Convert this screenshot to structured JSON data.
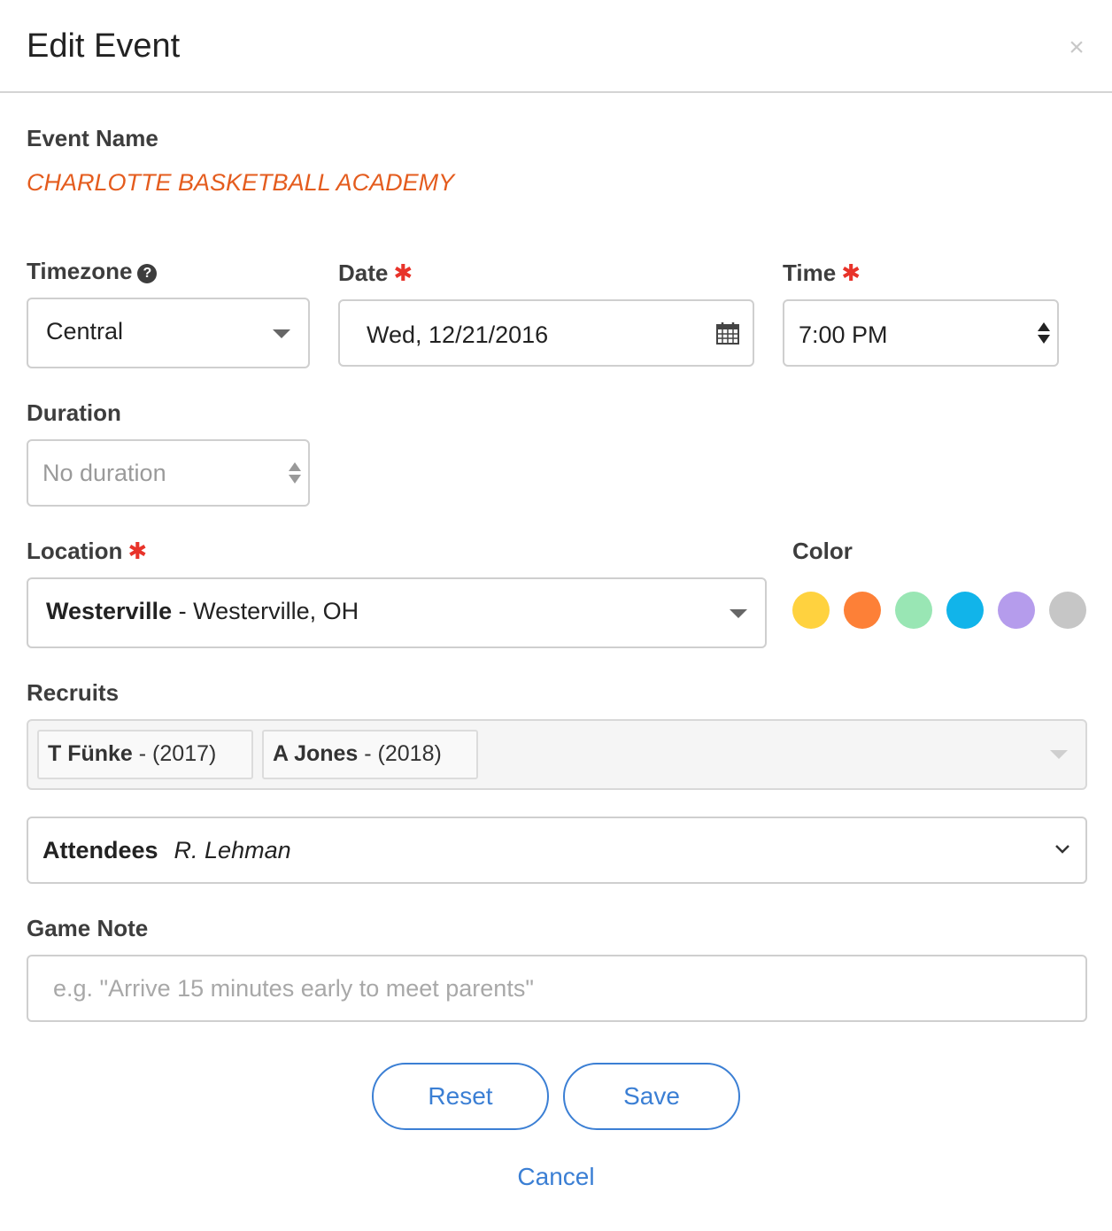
{
  "header": {
    "title": "Edit Event",
    "close_icon": "×"
  },
  "event_name": {
    "label": "Event Name",
    "value": "CHARLOTTE BASKETBALL ACADEMY"
  },
  "timezone": {
    "label": "Timezone",
    "help_icon": "?",
    "value": "Central"
  },
  "date": {
    "label": "Date",
    "required_mark": "✱",
    "value": "Wed, 12/21/2016"
  },
  "time": {
    "label": "Time",
    "required_mark": "✱",
    "value": "7:00 PM"
  },
  "duration": {
    "label": "Duration",
    "placeholder": "No duration"
  },
  "location": {
    "label": "Location",
    "required_mark": "✱",
    "name": "Westerville",
    "separator": " - ",
    "detail": "Westerville, OH"
  },
  "color": {
    "label": "Color",
    "swatches": [
      "#ffd23f",
      "#fd8037",
      "#99e6b4",
      "#11b4ea",
      "#b59cec",
      "#c6c6c6"
    ]
  },
  "recruits": {
    "label": "Recruits",
    "tags": [
      {
        "name": "T Fünke",
        "year": " - (2017)"
      },
      {
        "name": "A Jones",
        "year": " - (2018)"
      }
    ]
  },
  "attendees": {
    "label": "Attendees",
    "value": "R. Lehman"
  },
  "game_note": {
    "label": "Game Note",
    "placeholder": "e.g. \"Arrive 15 minutes early to meet parents\""
  },
  "actions": {
    "reset": "Reset",
    "save": "Save",
    "cancel": "Cancel"
  },
  "colors": {
    "accent": "#3b7fd4",
    "event_name": "#e45c1e",
    "required": "#e8332a"
  }
}
